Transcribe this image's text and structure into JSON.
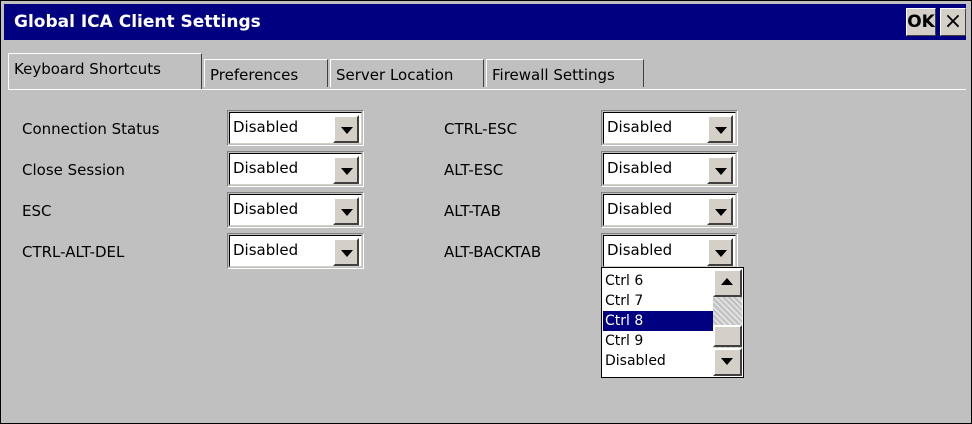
{
  "window": {
    "title": "Global ICA Client Settings",
    "ok_label": "OK",
    "close_label": "×"
  },
  "tabs": [
    {
      "label": "Keyboard Shortcuts",
      "active": true
    },
    {
      "label": "Preferences",
      "active": false
    },
    {
      "label": "Server Location",
      "active": false
    },
    {
      "label": "Firewall Settings",
      "active": false
    }
  ],
  "left_fields": [
    {
      "label": "Connection Status",
      "value": "Disabled"
    },
    {
      "label": "Close Session",
      "value": "Disabled"
    },
    {
      "label": "ESC",
      "value": "Disabled"
    },
    {
      "label": "CTRL-ALT-DEL",
      "value": "Disabled"
    }
  ],
  "right_fields": [
    {
      "label": "CTRL-ESC",
      "value": "Disabled"
    },
    {
      "label": "ALT-ESC",
      "value": "Disabled"
    },
    {
      "label": "ALT-TAB",
      "value": "Disabled"
    },
    {
      "label": "ALT-BACKTAB",
      "value": "Disabled"
    }
  ],
  "dropdown_list": {
    "items": [
      "Ctrl 6",
      "Ctrl 7",
      "Ctrl 8",
      "Ctrl 9",
      "Disabled"
    ],
    "selected": "Ctrl 8"
  },
  "colors": {
    "title_bar": "#000080",
    "background": "#c0c0c0",
    "selection": "#000080"
  }
}
